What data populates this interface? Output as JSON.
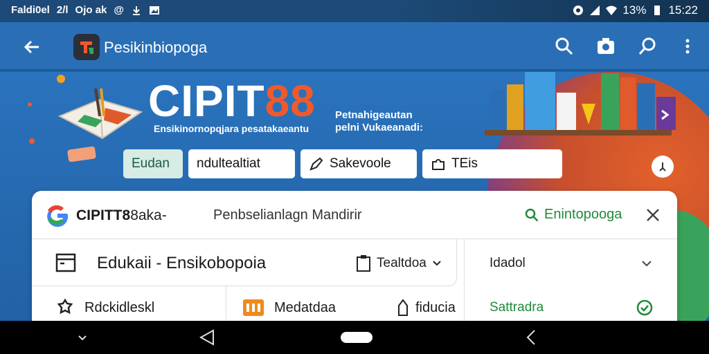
{
  "status_bar": {
    "left_text_1": "Faldi0el",
    "left_text_2": "2/l",
    "left_text_3": "Ojo ak",
    "left_text_4": "@",
    "battery": "13%",
    "time": "15:22"
  },
  "app_bar": {
    "title": "Pesikinbiopoga",
    "actions": [
      "search-icon",
      "camera-icon",
      "search-alt-icon",
      "more-vert-icon"
    ]
  },
  "hero": {
    "title_white": "CIPIT",
    "title_orange": "88",
    "subtitle": "Ensikinornopqjara pesatakaeantu",
    "right_line_1": "Petnahigeautan",
    "right_line_2": "pelni Vukaeanadi:",
    "chips": [
      {
        "label": "Eudan",
        "icon": ""
      },
      {
        "label": "ndultealtiat",
        "icon": ""
      },
      {
        "label": "Sakevoole",
        "icon": "pencil-icon"
      },
      {
        "label": "TEis",
        "icon": "puzzle-icon"
      }
    ]
  },
  "card": {
    "brand_bold": "CIPITT8",
    "brand_rest": "8aka-",
    "subtitle": "Penbselianlagn Mandirir",
    "search_label": "Enintopooga",
    "row1": {
      "title": "Edukaii - Ensikobopoia",
      "dropdown": "Tealtdoa"
    },
    "row2": [
      {
        "label": "Rdckidleskl",
        "icon": "gear-icon"
      },
      {
        "label": "Medatdaa",
        "icon": "media-icon"
      },
      {
        "label": "fiducia",
        "icon": "info-icon"
      }
    ],
    "right_panel": [
      {
        "label": "Idadol",
        "icon": "chevron-down-icon"
      },
      {
        "label": "Sattradra",
        "icon": "check-circle-icon"
      }
    ]
  },
  "colors": {
    "appbar": "#2a6fb6",
    "accent_orange": "#f05a2b",
    "accent_green": "#1f8a3a"
  }
}
